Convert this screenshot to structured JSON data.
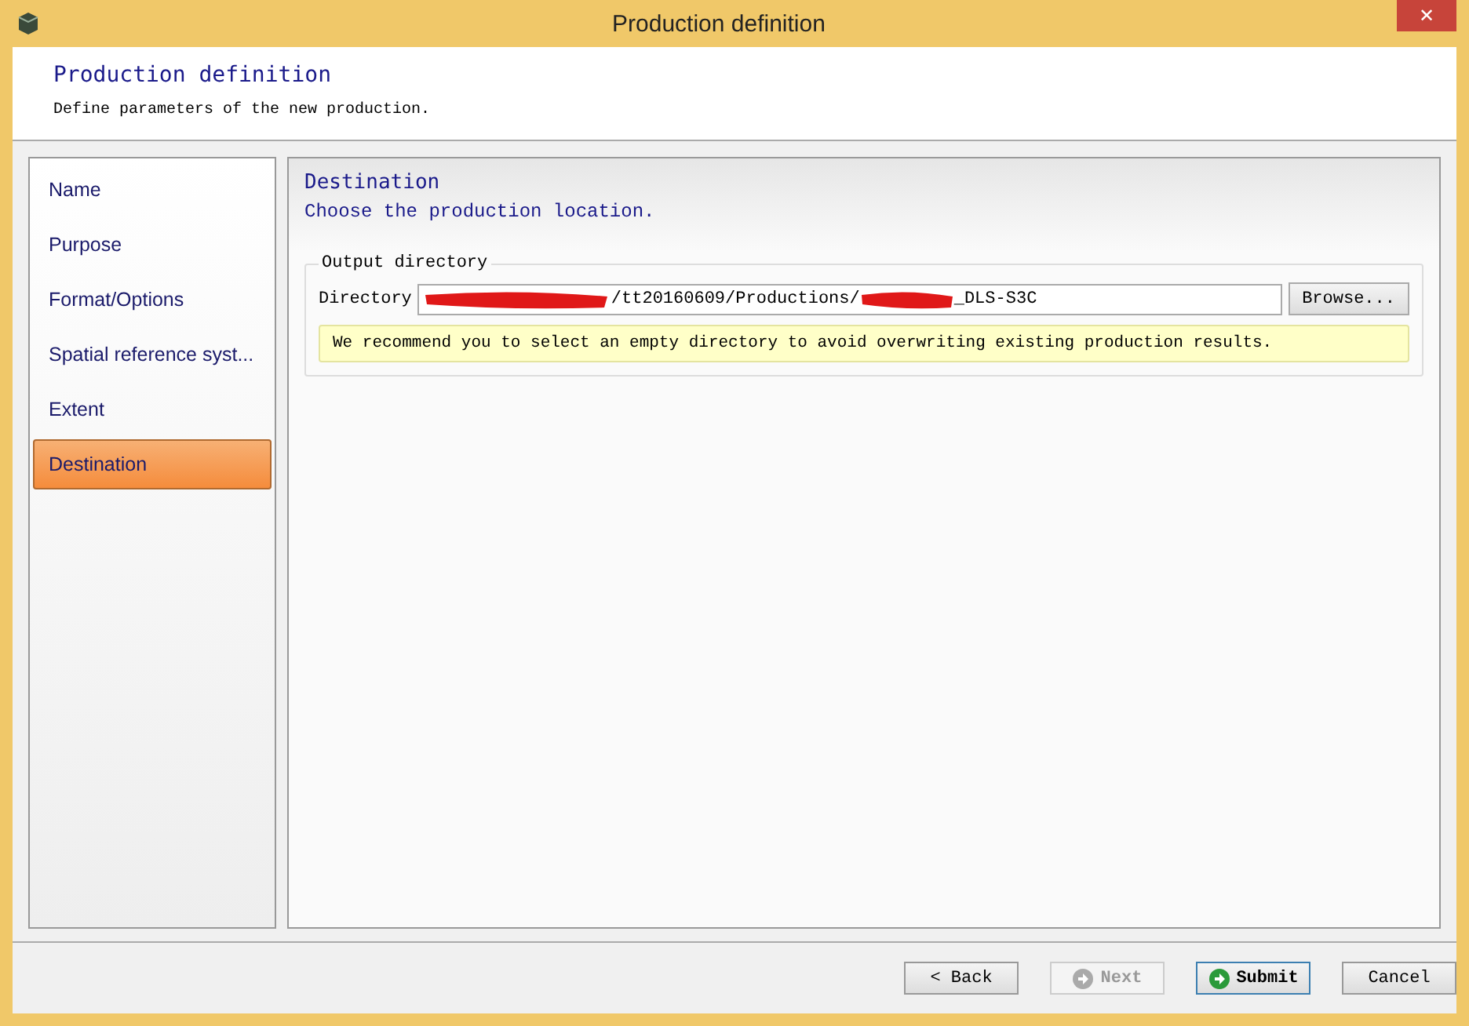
{
  "window": {
    "title": "Production definition",
    "close": "✕"
  },
  "header": {
    "title": "Production definition",
    "subtitle": "Define parameters of the new production."
  },
  "steps": [
    {
      "label": "Name",
      "selected": false
    },
    {
      "label": "Purpose",
      "selected": false
    },
    {
      "label": "Format/Options",
      "selected": false
    },
    {
      "label": "Spatial reference syst...",
      "selected": false
    },
    {
      "label": "Extent",
      "selected": false
    },
    {
      "label": "Destination",
      "selected": true
    }
  ],
  "page": {
    "title": "Destination",
    "subtitle": "Choose the production location."
  },
  "group": {
    "title": "Output directory",
    "field_label": "Directory",
    "value_segments": [
      {
        "kind": "redacted"
      },
      {
        "kind": "text",
        "text": "/tt20160609/Productions/"
      },
      {
        "kind": "redacted"
      },
      {
        "kind": "text",
        "text": "_DLS-S3C"
      }
    ],
    "browse": "Browse...",
    "hint": "We recommend you to select an empty directory to avoid overwriting existing production results."
  },
  "buttons": [
    {
      "label": "< Back",
      "kind": "plain",
      "disabled": false,
      "focused": false
    },
    {
      "label": "Next",
      "kind": "arrow",
      "disabled": true,
      "focused": false
    },
    {
      "label": "Submit",
      "kind": "arrow",
      "disabled": false,
      "focused": true
    },
    {
      "label": "Cancel",
      "kind": "plain",
      "disabled": false,
      "focused": false
    }
  ]
}
